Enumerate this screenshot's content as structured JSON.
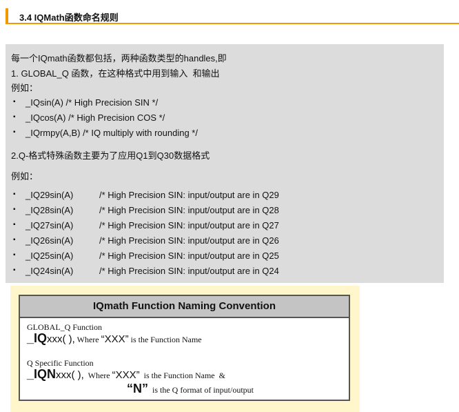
{
  "heading": "3.4 IQMath函数命名规则",
  "intro": [
    "每一个IQmath函数都包括，两种函数类型的handles,即",
    "1. GLOBAL_Q 函数，在这种格式中用到输入  和输出",
    "例如："
  ],
  "global_items": [
    "_IQsin(A) /* High Precision SIN */",
    "_IQcos(A) /* High Precision COS */",
    "_IQrmpy(A,B) /* IQ multiply with rounding */"
  ],
  "q_heading": "2.Q-格式特殊函数主要为了应用Q1到Q30数据格式",
  "q_example": "例如：",
  "bullet": "▪",
  "q_items": [
    {
      "fn": "_IQ29sin(A)",
      "comment": "/* High Precision SIN: input/output are in Q29"
    },
    {
      "fn": "_IQ28sin(A)",
      "comment": "/* High Precision SIN: input/output are in Q28"
    },
    {
      "fn": "_IQ27sin(A)",
      "comment": "/* High Precision SIN: input/output are in Q27"
    },
    {
      "fn": "_IQ26sin(A)",
      "comment": "/* High Precision SIN: input/output are in Q26"
    },
    {
      "fn": "_IQ25sin(A)",
      "comment": "/* High Precision SIN: input/output are in Q25"
    },
    {
      "fn": "_IQ24sin(A)",
      "comment": "/* High Precision SIN: input/output are in Q24"
    }
  ],
  "figure": {
    "title": "IQmath Function Naming Convention",
    "g_label": "GLOBAL_Q Function",
    "g_prefix": "_IQ",
    "g_xxx": "xxx( ),",
    "g_where": " Where ",
    "g_q": "“XXX”",
    "g_rest": " is the Function Name",
    "q_label": "Q Specific Function",
    "q_prefix": "_IQN",
    "q_xxx": "xxx( ),",
    "q_where": "  Where ",
    "q_q": "“XXX”",
    "q_rest": "  is the Function Name  &",
    "n_q": "“N”",
    "n_rest": "  is the Q format of input/output"
  }
}
